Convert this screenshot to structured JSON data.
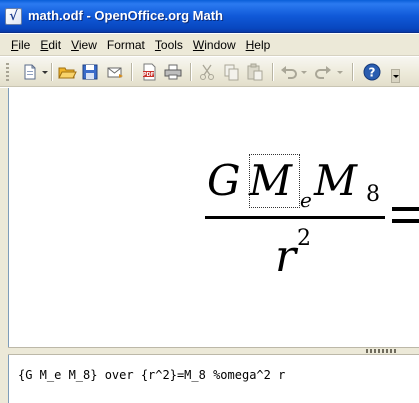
{
  "window": {
    "title": "math.odf - OpenOffice.org Math",
    "icon": "math-document-icon"
  },
  "menu": {
    "items": [
      {
        "label": "File",
        "underline": "F",
        "rest": "ile"
      },
      {
        "label": "Edit",
        "underline": "E",
        "rest": "dit"
      },
      {
        "label": "View",
        "underline": "V",
        "rest": "iew"
      },
      {
        "label": "Format",
        "underline": "F",
        "rest": "ormat",
        "underline_index": 0
      },
      {
        "label": "Tools",
        "underline": "T",
        "rest": "ools"
      },
      {
        "label": "Window",
        "underline": "W",
        "rest": "indow"
      },
      {
        "label": "Help",
        "underline": "H",
        "rest": "elp"
      }
    ]
  },
  "toolbar": {
    "buttons": [
      {
        "name": "new-document",
        "icon": "new-document-icon",
        "enabled": true,
        "has_dropdown": true
      },
      {
        "name": "open",
        "icon": "folder-open-icon",
        "enabled": true
      },
      {
        "name": "save",
        "icon": "floppy-disk-icon",
        "enabled": true
      },
      {
        "name": "email",
        "icon": "envelope-icon",
        "enabled": true
      },
      {
        "name": "export-pdf",
        "icon": "pdf-icon",
        "enabled": true
      },
      {
        "name": "print",
        "icon": "printer-icon",
        "enabled": true
      },
      {
        "name": "cut",
        "icon": "scissors-icon",
        "enabled": false
      },
      {
        "name": "copy",
        "icon": "copy-icon",
        "enabled": false
      },
      {
        "name": "paste",
        "icon": "clipboard-icon",
        "enabled": false
      },
      {
        "name": "undo",
        "icon": "undo-icon",
        "enabled": false,
        "has_dropdown": true
      },
      {
        "name": "redo",
        "icon": "redo-icon",
        "enabled": false,
        "has_dropdown": true
      },
      {
        "name": "help",
        "icon": "help-icon",
        "enabled": true
      }
    ],
    "colors": {
      "help": "#2a5db0",
      "pdf": "#c8312a",
      "folder": "#f0b429",
      "disabled": "#a9a697"
    }
  },
  "formula": {
    "numerator": {
      "g": "G",
      "m1": "M",
      "sub1": "e",
      "m2": "M",
      "sub2": "8"
    },
    "denominator": {
      "base": "r",
      "exponent": "2"
    }
  },
  "command": {
    "text": "{G M_e M_8} over {r^2}=M_8 %omega^2 r"
  },
  "colors": {
    "title_bar": "#0a5fd8",
    "chrome": "#ece9d8",
    "document_bg": "#ffffff",
    "text": "#000000"
  }
}
